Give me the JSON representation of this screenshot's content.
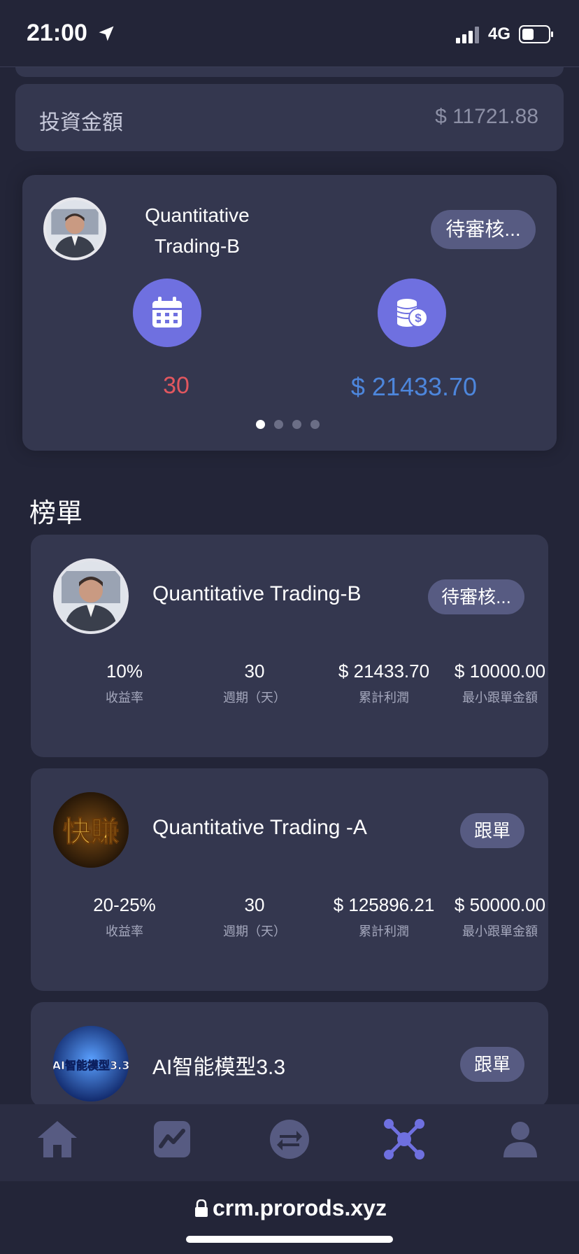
{
  "status_bar": {
    "time": "21:00",
    "network": "4G"
  },
  "investment": {
    "label": "投資金額",
    "value": "$ 11721.88"
  },
  "carousel": {
    "name_line1": "Quantitative",
    "name_line2": "Trading-B",
    "status": "待審核...",
    "days": "30",
    "amount": "$ 21433.70",
    "active_page": 1,
    "page_count": 4
  },
  "leaderboard": {
    "title": "榜單",
    "items": [
      {
        "name": "Quantitative Trading-B",
        "button": "待審核...",
        "stats": [
          {
            "value": "10%",
            "label": "收益率"
          },
          {
            "value": "30",
            "label": "週期（天）"
          },
          {
            "value": "$ 21433.70",
            "label": "累計利潤"
          },
          {
            "value": "$ 10000.00",
            "label": "最小跟單金額"
          }
        ]
      },
      {
        "name": "Quantitative Trading -A",
        "button": "跟單",
        "stats": [
          {
            "value": "20-25%",
            "label": "收益率"
          },
          {
            "value": "30",
            "label": "週期（天）"
          },
          {
            "value": "$ 125896.21",
            "label": "累計利潤"
          },
          {
            "value": "$ 50000.00",
            "label": "最小跟單金額"
          }
        ]
      },
      {
        "name": "AI智能模型3.3",
        "button": "跟單",
        "avatar_text": "AI智能模型3.3"
      }
    ]
  },
  "avatar_b_text": "快賺",
  "nav": {
    "items": [
      "home-icon",
      "chart-icon",
      "exchange-icon",
      "network-icon",
      "user-icon"
    ],
    "active_index": 3
  },
  "browser": {
    "url": "crm.prorods.xyz"
  },
  "colors": {
    "background": "#232538",
    "card": "#34374f",
    "accent": "#6f70e0",
    "days": "#e2575f",
    "amount": "#4d86dc",
    "button": "#575b82"
  }
}
